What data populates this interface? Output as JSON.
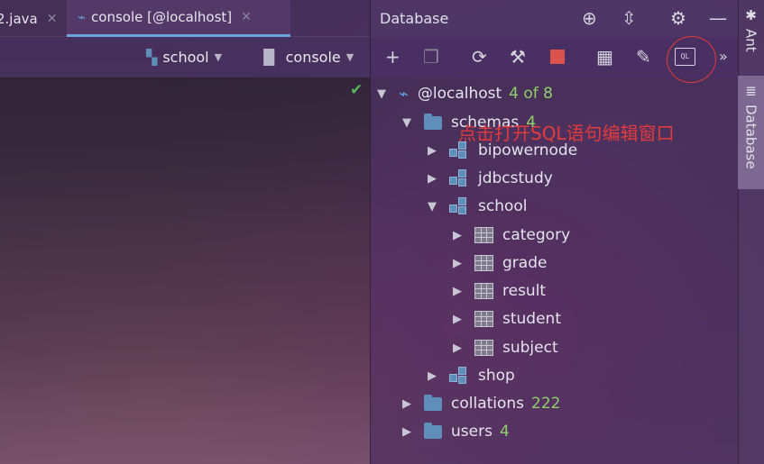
{
  "tabs": [
    {
      "label": "2.java",
      "close": "✕"
    },
    {
      "label": "console [@localhost]",
      "close": "✕"
    }
  ],
  "editor_toolbar": {
    "schema_selector": "school",
    "console_selector": "console"
  },
  "db_panel": {
    "title": "Database",
    "header_icons": [
      "crosshair-icon",
      "collapse-icon",
      "gear-icon",
      "minimize-icon"
    ],
    "toolbar_icons": [
      "add-icon",
      "duplicate-icon",
      "refresh-icon",
      "schema-sync-icon",
      "stop-icon",
      "table-view-icon",
      "edit-icon",
      "sql-console-icon",
      "more-icon"
    ],
    "sql_button_text": "QL",
    "more": "»"
  },
  "annotation": "点击打开SQL语句编辑窗口",
  "tree": {
    "datasource": {
      "label": "@localhost",
      "count": "4 of 8"
    },
    "schemas": {
      "label": "schemas",
      "count": "4"
    },
    "schema_items": [
      "bipowernode",
      "jdbcstudy",
      "school"
    ],
    "tables": [
      "category",
      "grade",
      "result",
      "student",
      "subject"
    ],
    "shop": "shop",
    "collations": {
      "label": "collations",
      "count": "222"
    },
    "users": {
      "label": "users",
      "count": "4"
    }
  },
  "side_tabs": {
    "ant": "Ant",
    "database": "Database"
  },
  "colors": {
    "accent_blue": "#5fa3e0",
    "count_green": "#8fd06a",
    "annotation_red": "#e33b3b",
    "check_green": "#58b35a"
  }
}
